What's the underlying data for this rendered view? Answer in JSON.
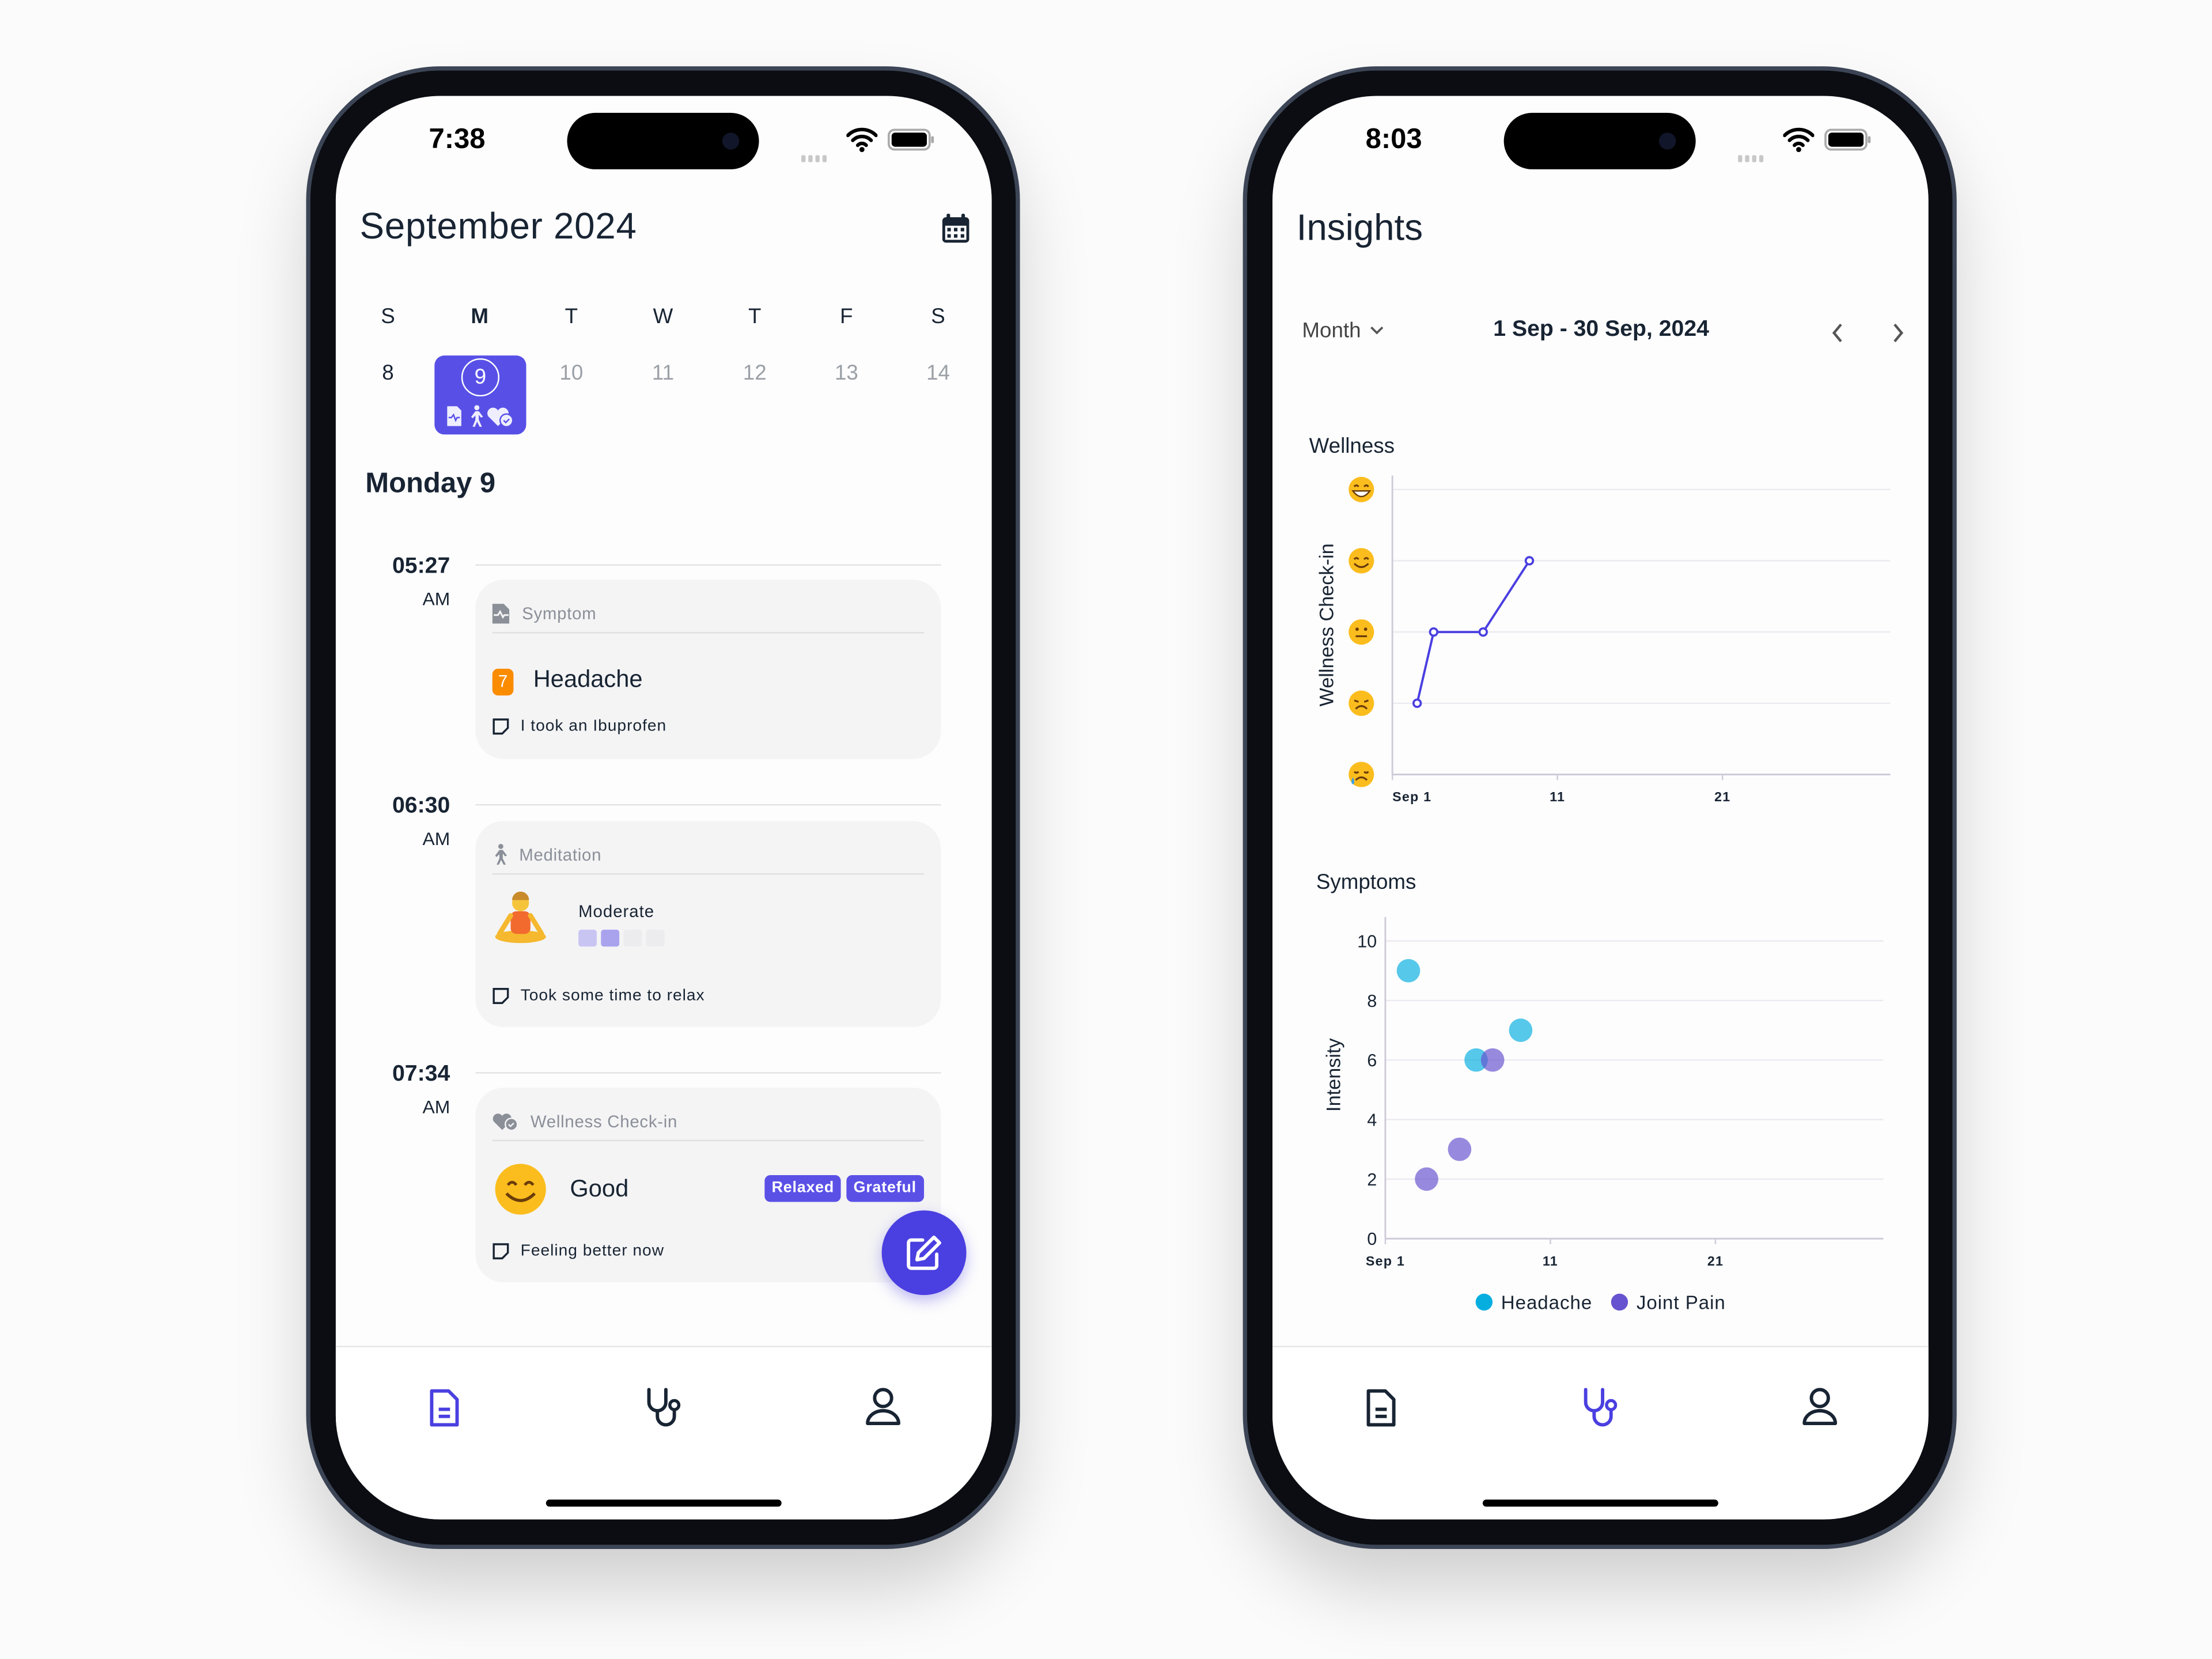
{
  "colors": {
    "accent": "#5850e6",
    "fab": "#4a3fe0",
    "severity": "#fb8c00",
    "headache": "#06aee0",
    "joint_pain": "#6553cf",
    "text": "#182433"
  },
  "phone1": {
    "status_time": "7:38",
    "title": "September 2024",
    "calendar_icon": "calendar-icon",
    "weekdays": [
      "S",
      "M",
      "T",
      "W",
      "T",
      "F",
      "S"
    ],
    "dates": [
      "8",
      "9",
      "10",
      "11",
      "12",
      "13",
      "14"
    ],
    "selected_date": "9",
    "day_heading": "Monday 9",
    "entries": [
      {
        "time": "05:27",
        "ampm": "AM",
        "type": "Symptom",
        "severity": "7",
        "name": "Headache",
        "note": "I took an Ibuprofen"
      },
      {
        "time": "06:30",
        "ampm": "AM",
        "type": "Meditation",
        "level": "Moderate",
        "level_value": 2,
        "level_max": 4,
        "note": "Took some time to relax"
      },
      {
        "time": "07:34",
        "ampm": "AM",
        "type": "Wellness Check-in",
        "mood": "Good",
        "tags": [
          "Relaxed",
          "Grateful"
        ],
        "note": "Feeling better now"
      }
    ],
    "nav": [
      {
        "icon": "document-icon",
        "active": true
      },
      {
        "icon": "stethoscope-icon",
        "active": false
      },
      {
        "icon": "user-icon",
        "active": false
      }
    ]
  },
  "phone2": {
    "status_time": "8:03",
    "title": "Insights",
    "period": "Month",
    "range": "1 Sep - 30 Sep, 2024",
    "nav": [
      {
        "icon": "document-icon",
        "active": false
      },
      {
        "icon": "stethoscope-icon",
        "active": true
      },
      {
        "icon": "user-icon",
        "active": false
      }
    ]
  },
  "chart_data": [
    {
      "type": "line",
      "title": "Wellness",
      "ylabel": "Wellness Check-in",
      "y_levels": [
        "crying",
        "sad",
        "neutral",
        "smiling",
        "grinning"
      ],
      "ylim": [
        1,
        5
      ],
      "xlim": [
        1,
        30
      ],
      "x_ticks": [
        {
          "value": 1,
          "label": "Sep 1"
        },
        {
          "value": 11,
          "label": "11"
        },
        {
          "value": 21,
          "label": "21"
        }
      ],
      "grid": "horizontal",
      "series": [
        {
          "x": [
            2.5,
            3.5,
            6.5,
            9.3
          ],
          "y": [
            2,
            3,
            3,
            4
          ],
          "color": "#4a3fe0"
        }
      ]
    },
    {
      "type": "scatter",
      "title": "Symptoms",
      "ylabel": "Intensity",
      "ylim": [
        0,
        10
      ],
      "y_ticks": [
        0,
        2,
        4,
        6,
        8,
        10
      ],
      "xlim": [
        1,
        30
      ],
      "x_ticks": [
        {
          "value": 1,
          "label": "Sep 1"
        },
        {
          "value": 11,
          "label": "11"
        },
        {
          "value": 21,
          "label": "21"
        }
      ],
      "grid": "horizontal",
      "legend": "bottom",
      "series": [
        {
          "name": "Headache",
          "color": "#06aee0",
          "x": [
            2.4,
            6.5,
            9.2
          ],
          "y": [
            9,
            6,
            7
          ]
        },
        {
          "name": "Joint Pain",
          "color": "#6553cf",
          "x": [
            3.5,
            5.5,
            7.5
          ],
          "y": [
            2,
            3,
            6
          ]
        }
      ]
    }
  ]
}
